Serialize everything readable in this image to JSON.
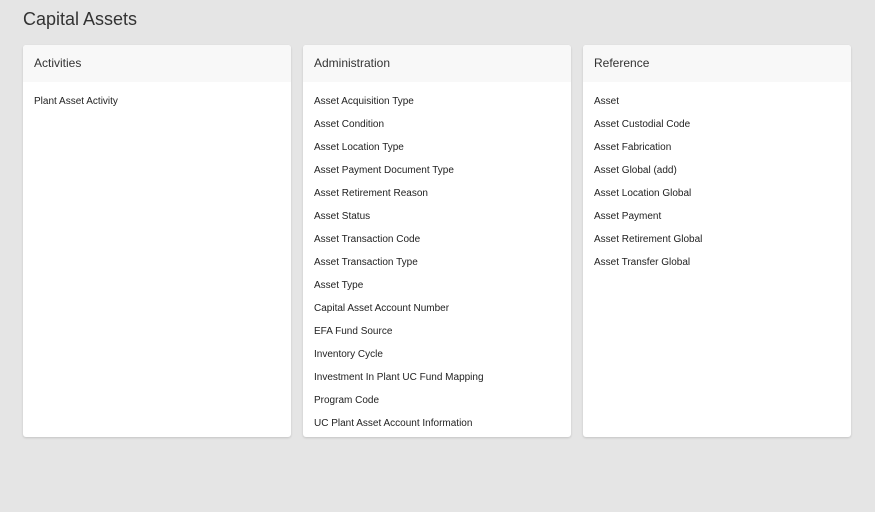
{
  "page_title": "Capital Assets",
  "panels": [
    {
      "title": "Activities",
      "items": [
        "Plant Asset Activity"
      ]
    },
    {
      "title": "Administration",
      "items": [
        "Asset Acquisition Type",
        "Asset Condition",
        "Asset Location Type",
        "Asset Payment Document Type",
        "Asset Retirement Reason",
        "Asset Status",
        "Asset Transaction Code",
        "Asset Transaction Type",
        "Asset Type",
        "Capital Asset Account Number",
        "EFA Fund Source",
        "Inventory Cycle",
        "Investment In Plant UC Fund Mapping",
        "Program Code",
        "UC Plant Asset Account Information"
      ]
    },
    {
      "title": "Reference",
      "items": [
        "Asset",
        "Asset Custodial Code",
        "Asset Fabrication",
        "Asset Global (add)",
        "Asset Location Global",
        "Asset Payment",
        "Asset Retirement Global",
        "Asset Transfer Global"
      ]
    }
  ]
}
